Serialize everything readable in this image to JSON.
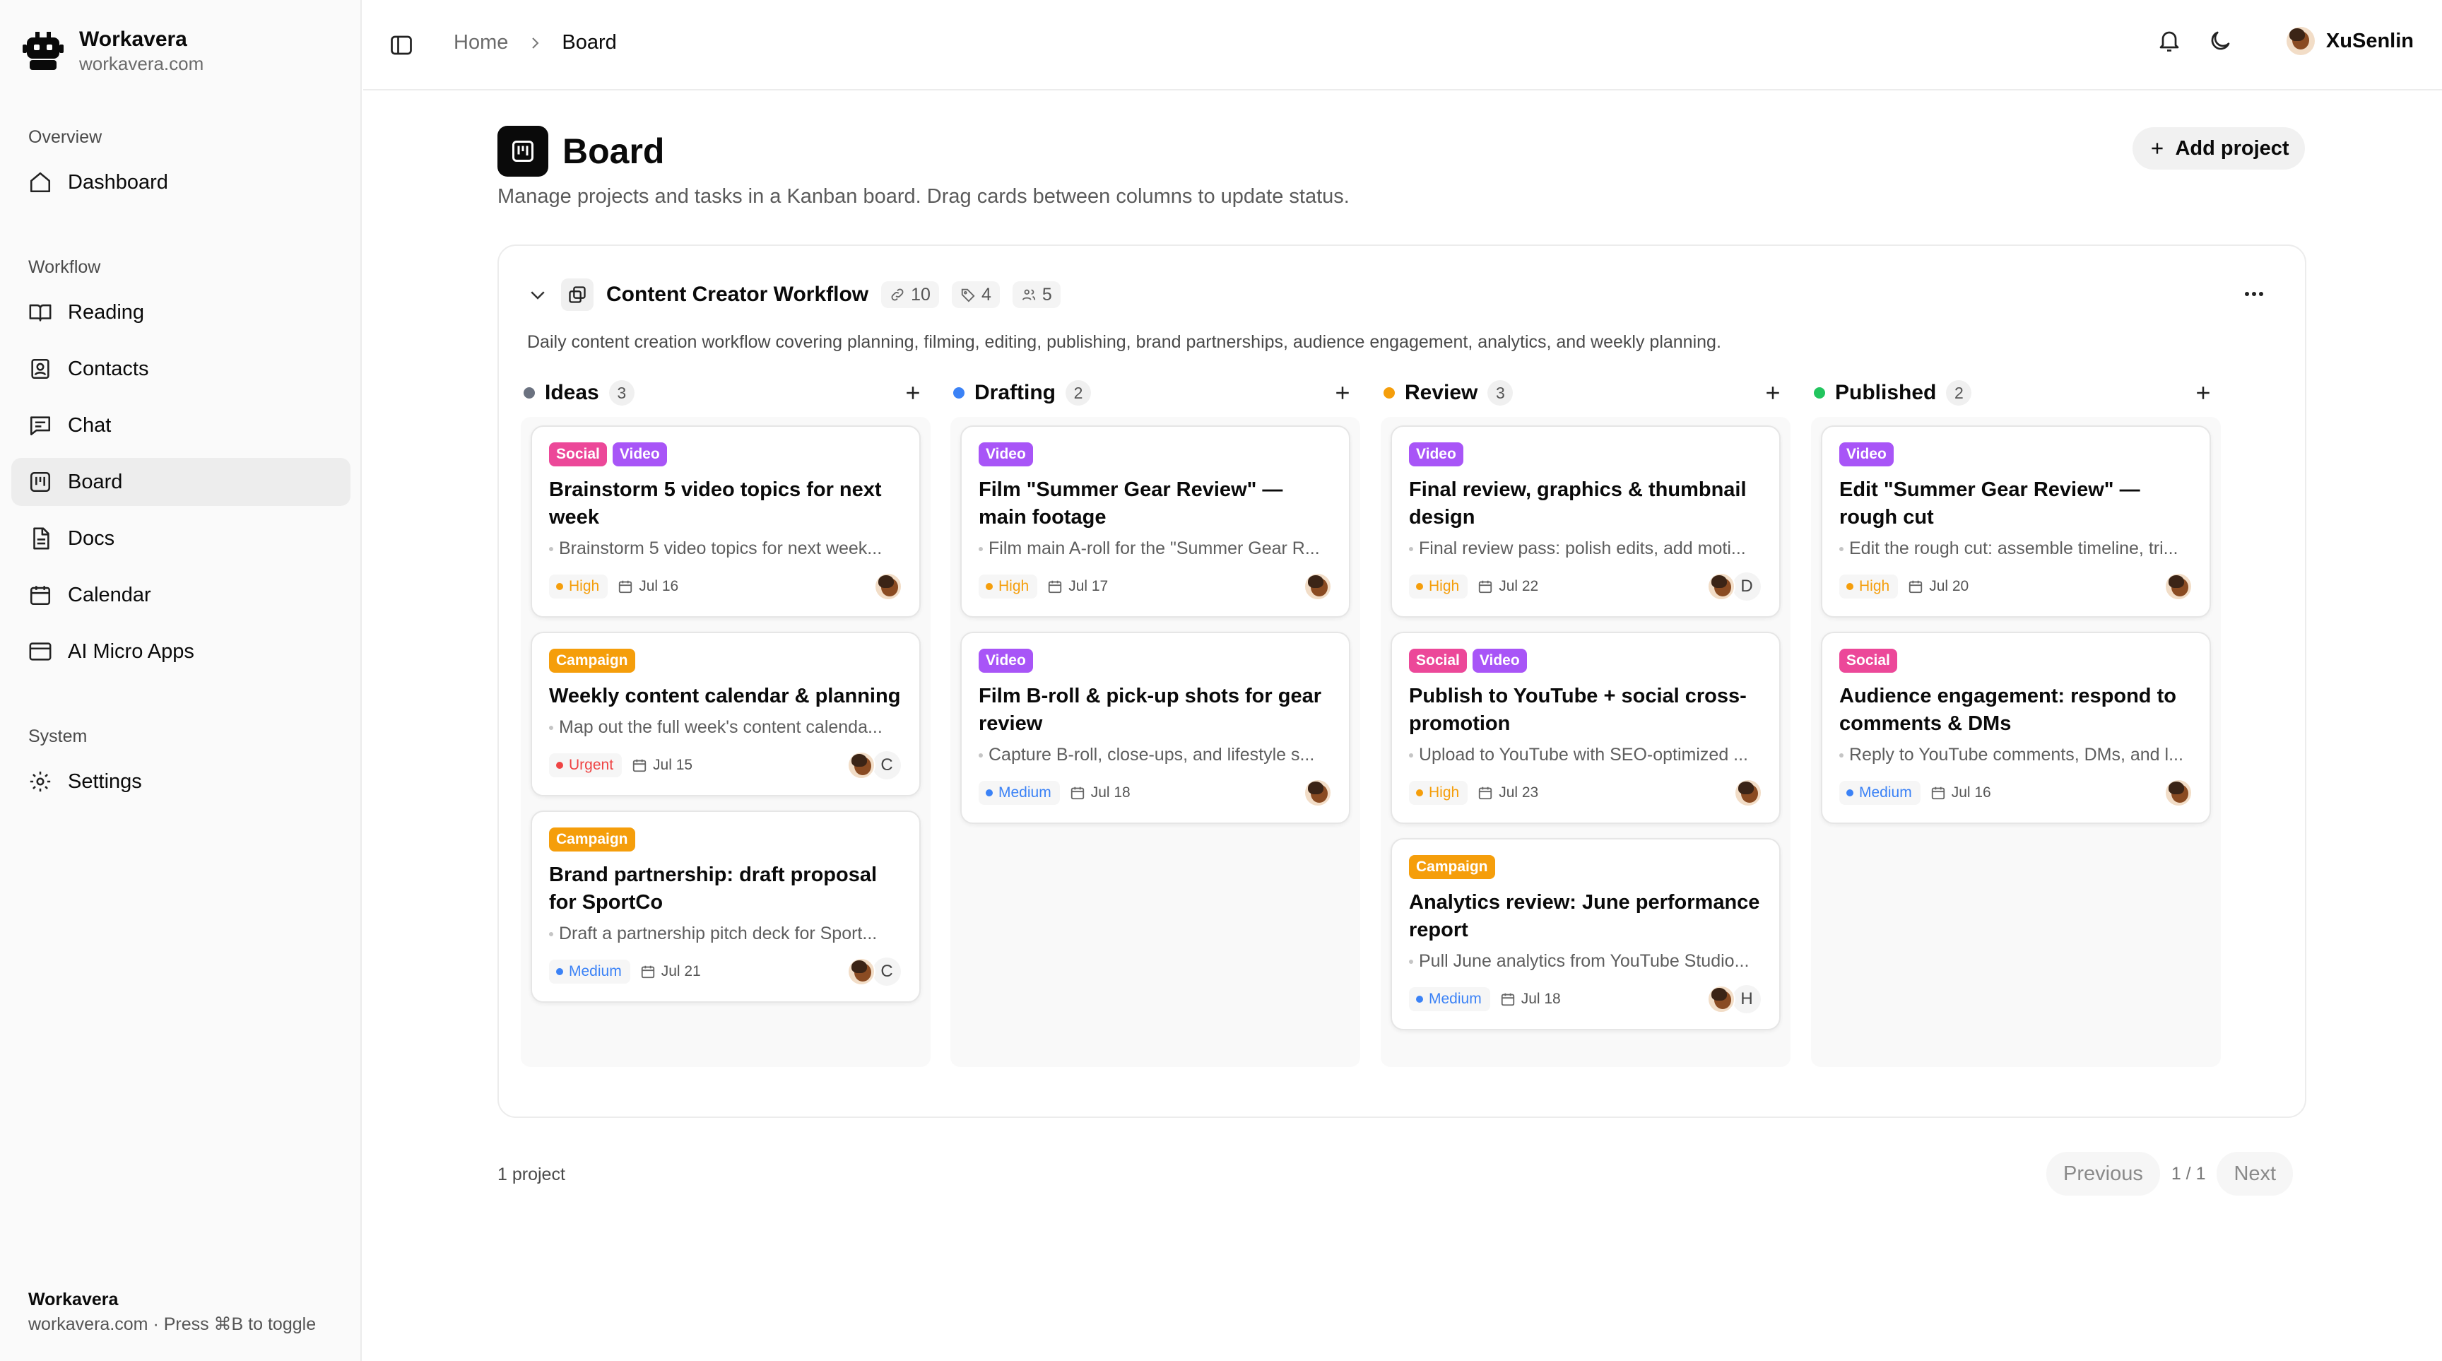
{
  "brand": {
    "name": "Workavera",
    "domain": "workavera.com"
  },
  "sidebar": {
    "groups": [
      {
        "title": "Overview",
        "items": [
          {
            "label": "Dashboard",
            "icon": "home-icon"
          }
        ]
      },
      {
        "title": "Workflow",
        "items": [
          {
            "label": "Reading",
            "icon": "book-open-icon"
          },
          {
            "label": "Contacts",
            "icon": "contact-icon"
          },
          {
            "label": "Chat",
            "icon": "chat-icon"
          },
          {
            "label": "Board",
            "icon": "kanban-icon",
            "active": true
          },
          {
            "label": "Docs",
            "icon": "document-icon"
          },
          {
            "label": "Calendar",
            "icon": "calendar-icon"
          },
          {
            "label": "AI Micro Apps",
            "icon": "app-window-icon"
          }
        ]
      },
      {
        "title": "System",
        "items": [
          {
            "label": "Settings",
            "icon": "gear-icon"
          }
        ]
      }
    ],
    "footer": {
      "name": "Workavera",
      "hint": "workavera.com · Press ⌘B to toggle"
    }
  },
  "header": {
    "breadcrumb": {
      "home": "Home",
      "current": "Board"
    },
    "user": "XuSenlin"
  },
  "page": {
    "title": "Board",
    "description": "Manage projects and tasks in a Kanban board. Drag cards between columns to update status.",
    "add_button": "Add project"
  },
  "project": {
    "name": "Content Creator Workflow",
    "stats": {
      "links": "10",
      "tags": "4",
      "members": "5"
    },
    "description": "Daily content creation workflow covering planning, filming, editing, publishing, brand partnerships, audience engagement, analytics, and weekly planning.",
    "columns": [
      {
        "title": "Ideas",
        "count": "3",
        "color": "#6b7280",
        "cards": [
          {
            "tags": [
              "Social",
              "Video"
            ],
            "title": "Brainstorm 5 video topics for next week",
            "desc": "Brainstorm 5 video topics for next week...",
            "priority": "High",
            "due": "Jul 16",
            "assignees": []
          },
          {
            "tags": [
              "Campaign"
            ],
            "title": "Weekly content calendar & planning",
            "desc": "Map out the full week's content calenda...",
            "priority": "Urgent",
            "due": "Jul 15",
            "assignees": [
              "C"
            ]
          },
          {
            "tags": [
              "Campaign"
            ],
            "title": "Brand partnership: draft proposal for SportCo",
            "desc": "Draft a partnership pitch deck for Sport...",
            "priority": "Medium",
            "due": "Jul 21",
            "assignees": [
              "C"
            ]
          }
        ]
      },
      {
        "title": "Drafting",
        "count": "2",
        "color": "#3b82f6",
        "cards": [
          {
            "tags": [
              "Video"
            ],
            "title": "Film \"Summer Gear Review\" — main footage",
            "desc": "Film main A-roll for the \"Summer Gear R...",
            "priority": "High",
            "due": "Jul 17",
            "assignees": []
          },
          {
            "tags": [
              "Video"
            ],
            "title": "Film B-roll & pick-up shots for gear review",
            "desc": "Capture B-roll, close-ups, and lifestyle s...",
            "priority": "Medium",
            "due": "Jul 18",
            "assignees": []
          }
        ]
      },
      {
        "title": "Review",
        "count": "3",
        "color": "#f59e0b",
        "cards": [
          {
            "tags": [
              "Video"
            ],
            "title": "Final review, graphics & thumbnail design",
            "desc": "Final review pass: polish edits, add moti...",
            "priority": "High",
            "due": "Jul 22",
            "assignees": [
              "D"
            ]
          },
          {
            "tags": [
              "Social",
              "Video"
            ],
            "title": "Publish to YouTube + social cross-promotion",
            "desc": "Upload to YouTube with SEO-optimized ...",
            "priority": "High",
            "due": "Jul 23",
            "assignees": []
          },
          {
            "tags": [
              "Campaign"
            ],
            "title": "Analytics review: June performance report",
            "desc": "Pull June analytics from YouTube Studio...",
            "priority": "Medium",
            "due": "Jul 18",
            "assignees": [
              "H"
            ]
          }
        ]
      },
      {
        "title": "Published",
        "count": "2",
        "color": "#22c55e",
        "cards": [
          {
            "tags": [
              "Video"
            ],
            "title": "Edit \"Summer Gear Review\" — rough cut",
            "desc": "Edit the rough cut: assemble timeline, tri...",
            "priority": "High",
            "due": "Jul 20",
            "assignees": []
          },
          {
            "tags": [
              "Social"
            ],
            "title": "Audience engagement: respond to comments & DMs",
            "desc": "Reply to YouTube comments, DMs, and l...",
            "priority": "Medium",
            "due": "Jul 16",
            "assignees": []
          }
        ]
      }
    ]
  },
  "tag_colors": {
    "Social": "#ec4899",
    "Video": "#a855f7",
    "Campaign": "#f59e0b"
  },
  "priority_colors": {
    "High": "#f59e0b",
    "Urgent": "#ef4444",
    "Medium": "#3b82f6"
  },
  "footer": {
    "count": "1 project",
    "previous": "Previous",
    "page": "1 / 1",
    "next": "Next"
  }
}
